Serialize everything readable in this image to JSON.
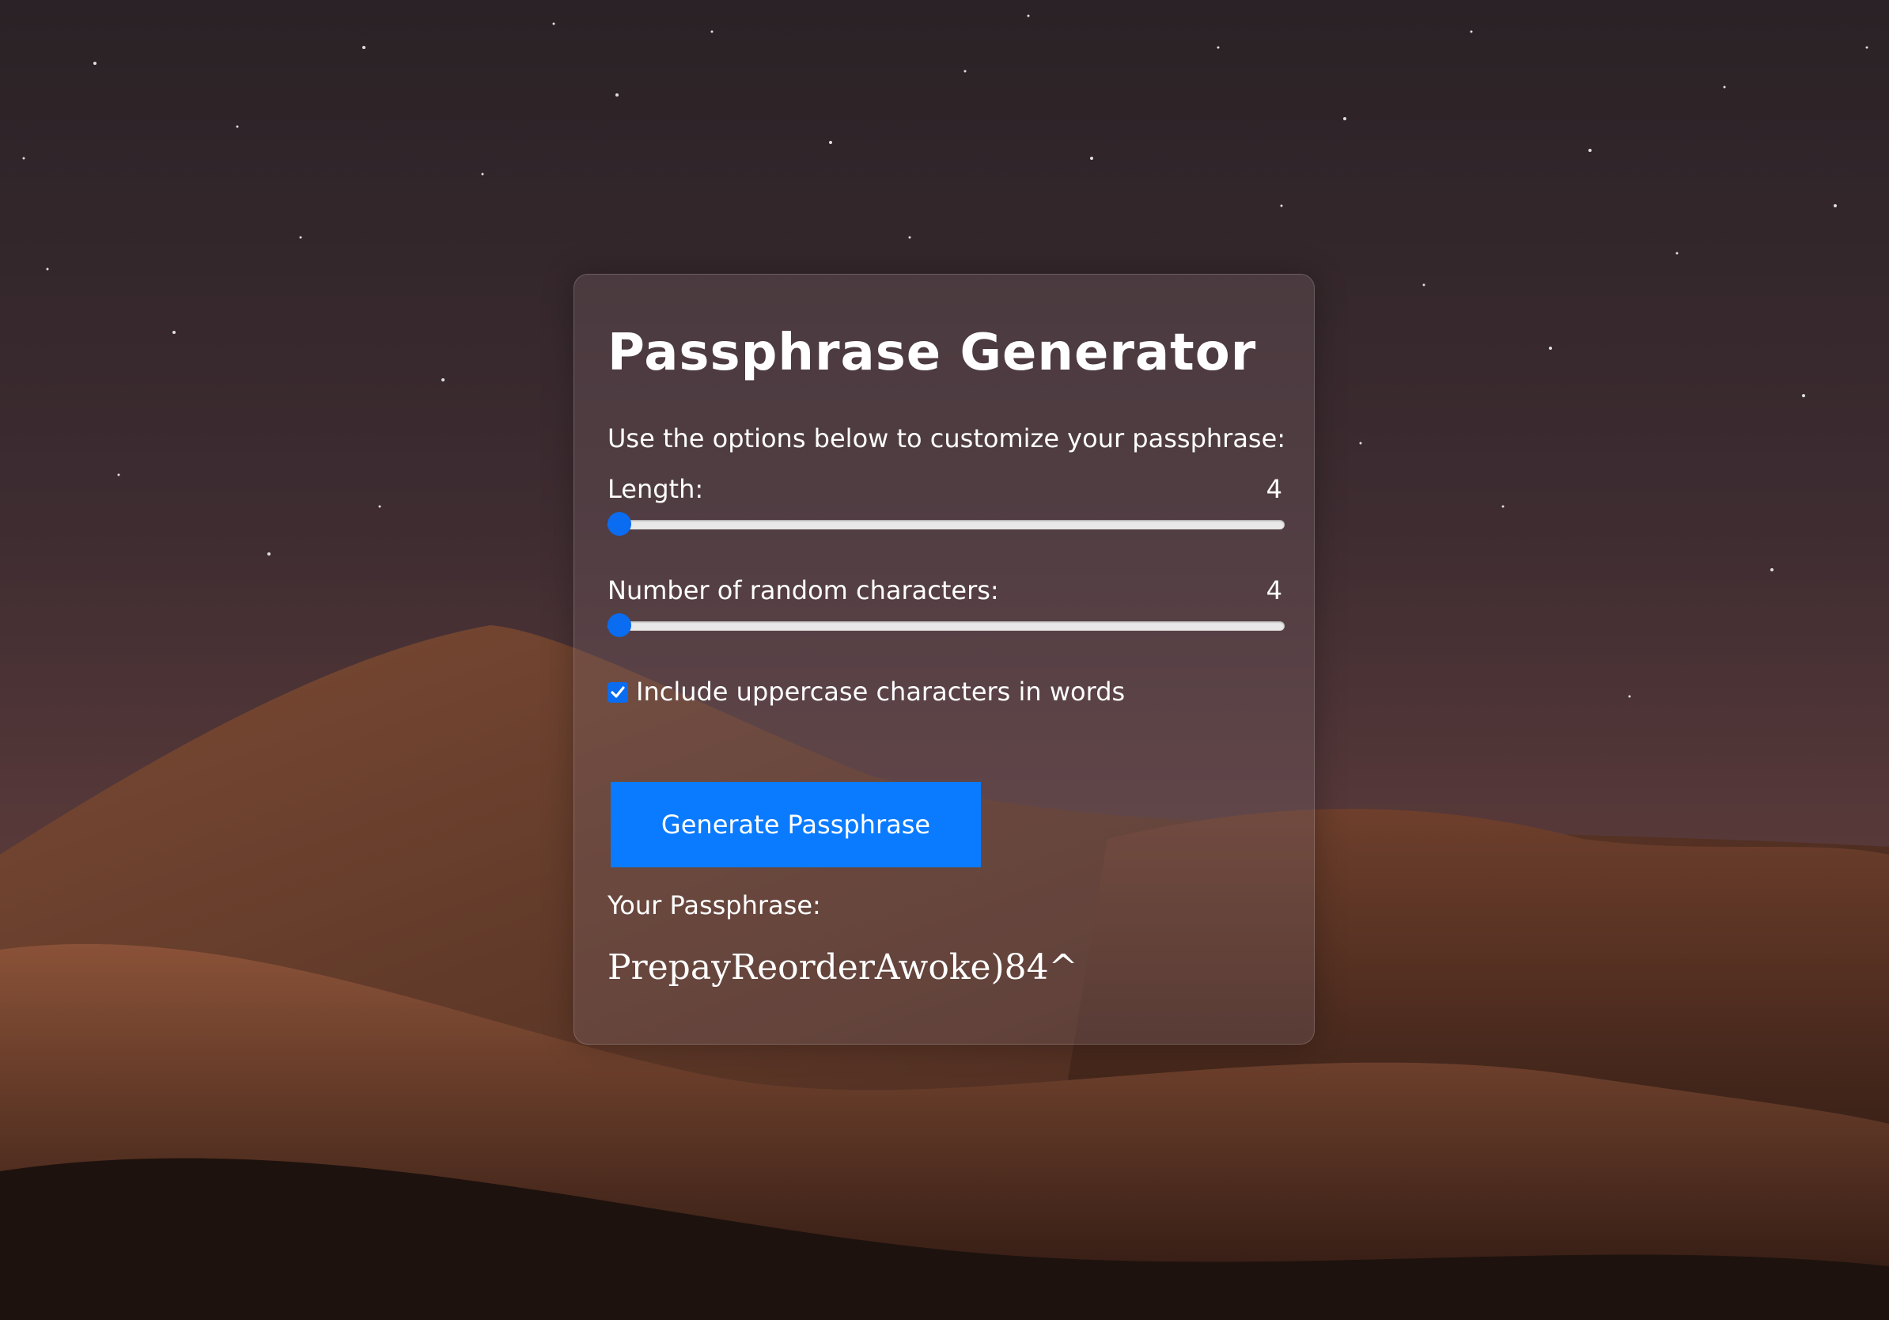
{
  "page": {
    "title": "Passphrase Generator",
    "subtitle": "Use the options below to customize your passphrase:"
  },
  "length": {
    "label": "Length:",
    "value": "4",
    "slider_fraction": 0.0
  },
  "random_chars": {
    "label": "Number of random characters:",
    "value": "4",
    "slider_fraction": 0.0
  },
  "uppercase": {
    "label": "Include uppercase characters in words",
    "checked": true
  },
  "generate_button": {
    "label": "Generate Passphrase"
  },
  "result": {
    "label": "Your Passphrase:",
    "value": "PrepayReorderAwoke)84^"
  },
  "colors": {
    "accent": "#0a7bff",
    "text": "#ffffff"
  },
  "icons": {
    "checkbox": "check-icon"
  }
}
